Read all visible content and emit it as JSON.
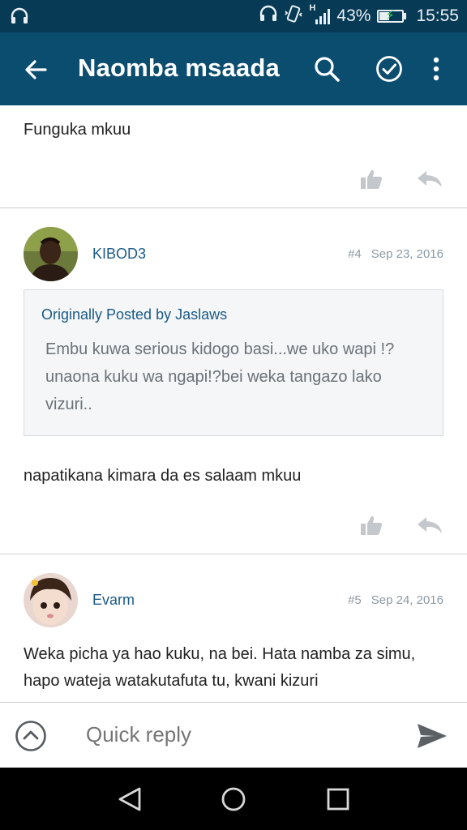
{
  "status_bar": {
    "network_type": "H",
    "battery_percent": "43%",
    "time": "15:55",
    "icons": [
      "headset-icon",
      "headset-icon",
      "vibrate-icon",
      "signal-icon",
      "battery-charging-icon"
    ]
  },
  "app_bar": {
    "title": "Naomba msaada",
    "icons": [
      "back-arrow-icon",
      "search-icon",
      "check-circle-icon",
      "more-vert-icon"
    ]
  },
  "posts": [
    {
      "text": "Funguka mkuu"
    },
    {
      "author": "KIBOD3",
      "number": "#4",
      "date": "Sep 23, 2016",
      "quote": {
        "header": "Originally Posted by Jaslaws",
        "text": "Embu kuwa serious kidogo basi...we uko wapi !?unaona kuku wa ngapi!?bei weka tangazo lako vizuri.."
      },
      "text": "napatikana kimara da es salaam mkuu"
    },
    {
      "author": "Evarm",
      "number": "#5",
      "date": "Sep 24, 2016",
      "text": "Weka picha ya hao kuku, na bei. Hata namba za simu, hapo wateja watakutafuta tu, kwani kizuri"
    }
  ],
  "quick_reply": {
    "placeholder": "Quick reply"
  },
  "colors": {
    "status_bar": "#073a55",
    "app_bar": "#0b4d6f",
    "link": "#1a5a86",
    "icon_grey": "#c4c8cc"
  }
}
